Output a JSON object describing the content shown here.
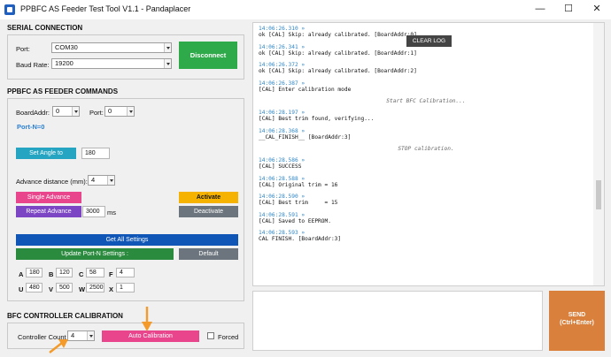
{
  "window": {
    "title": "PPBFC AS Feeder Test Tool V1.1 - Pandaplacer",
    "minimize": "—",
    "maximize": "☐",
    "close": "✕"
  },
  "serial": {
    "title": "SERIAL CONNECTION",
    "port_label": "Port:",
    "port_value": "COM30",
    "baud_label": "Baud Rate:",
    "baud_value": "19200",
    "disconnect_label": "Disconnect"
  },
  "feeder": {
    "title": "PPBFC AS FEEDER COMMANDS",
    "board_label": "BoardAddr:",
    "board_value": "0",
    "port_label": "Port:",
    "port_value": "0",
    "port_n": "Port-N=0",
    "set_angle_label": "Set Angle to",
    "set_angle_value": "180",
    "advance_label": "Advance distance (mm):",
    "advance_value": "4",
    "single_advance_label": "Single Advance",
    "activate_label": "Activate",
    "repeat_advance_label": "Repeat Advance",
    "repeat_value": "3000",
    "repeat_unit": "ms",
    "deactivate_label": "Deactivate",
    "get_all_label": "Get All Settings",
    "update_label": "Update Port-N Settings :",
    "default_label": "Default",
    "params_row1": [
      {
        "key": "A",
        "value": "180"
      },
      {
        "key": "B",
        "value": "120"
      },
      {
        "key": "C",
        "value": "58"
      },
      {
        "key": "F",
        "value": "4"
      }
    ],
    "params_row2": [
      {
        "key": "U",
        "value": "480"
      },
      {
        "key": "V",
        "value": "500"
      },
      {
        "key": "W",
        "value": "2500"
      },
      {
        "key": "X",
        "value": "1"
      }
    ]
  },
  "calibration": {
    "title": "BFC CONTROLLER CALIBRATION",
    "count_label": "Controller Count",
    "count_value": "4",
    "auto_label": "Auto Calibration",
    "forced_label": "Forced"
  },
  "log": {
    "clear_label": "CLEAR LOG",
    "entries": [
      {
        "ts": "14:06:26.310 »",
        "msg": "ok [CAL] Skip: already calibrated. [BoardAddr:0]"
      },
      {
        "ts": "14:06:26.341 »",
        "msg": "ok [CAL] Skip: already calibrated. [BoardAddr:1]"
      },
      {
        "ts": "14:06:26.372 »",
        "msg": "ok [CAL] Skip: already calibrated. [BoardAddr:2]"
      },
      {
        "ts": "14:06:26.387 »",
        "msg": "[CAL] Enter calibration mode"
      },
      {
        "center": "Start BFC Calibration..."
      },
      {
        "ts": "14:06:28.197 »",
        "msg": "[CAL] Best trim found, verifying..."
      },
      {
        "ts": "14:06:28.368 »",
        "msg": "__CAL_FINISH__ [BoardAddr:3]"
      },
      {
        "center": "STOP calibration."
      },
      {
        "ts": "14:06:28.586 »",
        "msg": "[CAL] SUCCESS"
      },
      {
        "ts": "14:06:28.588 »",
        "msg": "[CAL] Original trim = 16"
      },
      {
        "ts": "14:06:28.590 »",
        "msg": "[CAL] Best trim     = 15"
      },
      {
        "ts": "14:06:28.591 »",
        "msg": "[CAL] Saved to EEPROM."
      },
      {
        "ts": "14:06:28.593 »",
        "msg": "CAL FINISH. [BoardAddr:3]"
      }
    ]
  },
  "send": {
    "label_line1": "SEND",
    "label_line2": "(Ctrl+Enter)"
  },
  "colors": {
    "green": "#2eaa4a",
    "teal": "#26a5c2",
    "pink": "#e8458c",
    "purple": "#7b45c4",
    "yellow": "#f5b300",
    "gray": "#6c757d",
    "blue": "#0f56b6",
    "darkgreen": "#2a8a3e",
    "orange": "#d9803d",
    "annotation": "#f39a2a"
  }
}
